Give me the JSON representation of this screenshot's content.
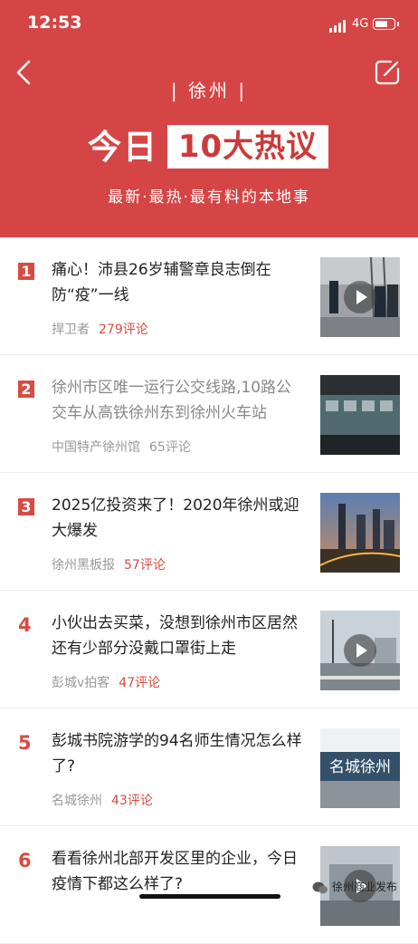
{
  "status_bar": {
    "time": "12:53",
    "network": "4G",
    "battery_level": 0.7
  },
  "header": {
    "city": "| 徐州 |",
    "title_prefix": "今日",
    "title_box": "10大热议",
    "subtitle": "最新·最热·最有料的本地事"
  },
  "items": [
    {
      "rank": "1",
      "rank_style": "boxed",
      "title": "痛心！沛县26岁辅警章良志倒在防“疫”一线",
      "source": "捍卫者",
      "comments": "279评论",
      "has_play": true,
      "read": false
    },
    {
      "rank": "2",
      "rank_style": "boxed",
      "title": "徐州市区唯一运行公交线路,10路公交车从高铁徐州东到徐州火车站",
      "source": "中国特产徐州馆",
      "comments": "65评论",
      "has_play": false,
      "read": true
    },
    {
      "rank": "3",
      "rank_style": "boxed",
      "title": "2025亿投资来了！2020年徐州或迎大爆发",
      "source": "徐州黑板报",
      "comments": "57评论",
      "has_play": false,
      "read": false
    },
    {
      "rank": "4",
      "rank_style": "plain",
      "title": "小伙出去买菜，没想到徐州市区居然还有少部分没戴口罩街上走",
      "source": "彭城v拍客",
      "comments": "47评论",
      "has_play": true,
      "read": false
    },
    {
      "rank": "5",
      "rank_style": "plain",
      "title": "彭城书院游学的94名师生情况怎么样了?",
      "source": "名城徐州",
      "comments": "43评论",
      "has_play": false,
      "read": false
    },
    {
      "rank": "6",
      "rank_style": "plain",
      "title": "看看徐州北部开发区里的企业，今日疫情下都这么样了?",
      "source": "",
      "comments": "",
      "has_play": true,
      "read": false
    }
  ],
  "thumb_text_5": "名城徐州",
  "watermark": "徐州商业发布",
  "colors": {
    "header": "#d64545",
    "accent": "#d84b41"
  }
}
